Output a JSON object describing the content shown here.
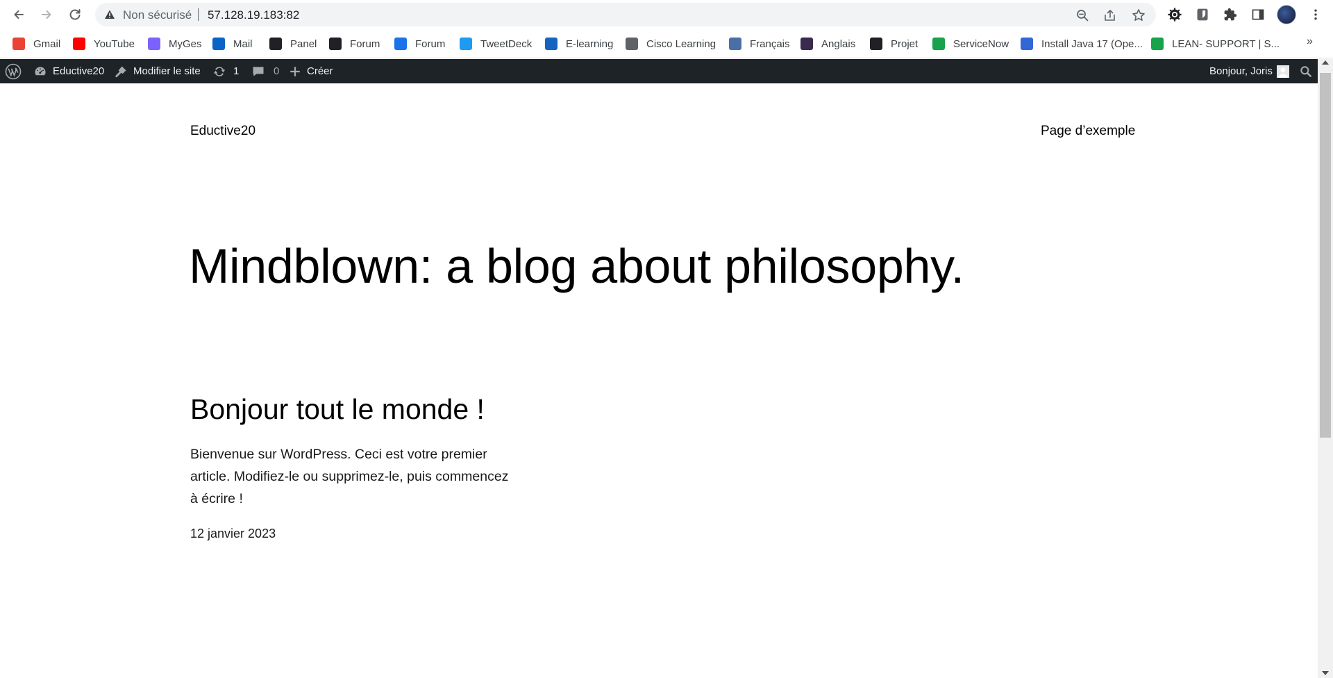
{
  "browser": {
    "security_label": "Non sécurisé",
    "url": "57.128.19.183:82",
    "bookmarks": [
      {
        "label": "Gmail",
        "icon": "gmail-icon",
        "color": "#ea4335"
      },
      {
        "label": "YouTube",
        "icon": "youtube-icon",
        "color": "#ff0000"
      },
      {
        "label": "MyGes",
        "icon": "myges-icon",
        "color": "#7b61ff"
      },
      {
        "label": "Mail",
        "icon": "outlook-icon",
        "color": "#0a64c8"
      },
      {
        "label": "Panel",
        "icon": "panel-icon",
        "color": "#202124"
      },
      {
        "label": "Forum",
        "icon": "forum-chat-icon",
        "color": "#202124"
      },
      {
        "label": "Forum",
        "icon": "forum-house-icon",
        "color": "#1a73e8"
      },
      {
        "label": "TweetDeck",
        "icon": "twitter-icon",
        "color": "#1d9bf0"
      },
      {
        "label": "E-learning",
        "icon": "elearning-icon",
        "color": "#1565c0"
      },
      {
        "label": "Cisco Learning",
        "icon": "cisco-icon",
        "color": "#5f6368"
      },
      {
        "label": "Français",
        "icon": "francais-icon",
        "color": "#4a6fa5"
      },
      {
        "label": "Anglais",
        "icon": "anglais-g-icon",
        "color": "#3b2a4f"
      },
      {
        "label": "Projet",
        "icon": "trello-icon",
        "color": "#202124"
      },
      {
        "label": "ServiceNow",
        "icon": "servicenow-icon",
        "color": "#17a34a"
      },
      {
        "label": "Install Java 17 (Ope...",
        "icon": "java-install-icon",
        "color": "#3367d6"
      },
      {
        "label": "LEAN- SUPPORT | S...",
        "icon": "lean-support-icon",
        "color": "#17a34a"
      }
    ],
    "more_label": "»"
  },
  "adminbar": {
    "site_name": "Eductive20",
    "edit_site": "Modifier le site",
    "updates_count": "1",
    "comments_count": "0",
    "new_label": "Créer",
    "greeting": "Bonjour, Joris"
  },
  "site": {
    "title": "Eductive20",
    "nav_link": "Page d’exemple",
    "hero": "Mindblown: a blog about philosophy."
  },
  "post": {
    "title": "Bonjour tout le monde !",
    "excerpt": "Bienvenue sur WordPress. Ceci est votre premier article. Modifiez-le ou supprimez-le, puis commencez à écrire !",
    "date": "12 janvier 2023"
  }
}
